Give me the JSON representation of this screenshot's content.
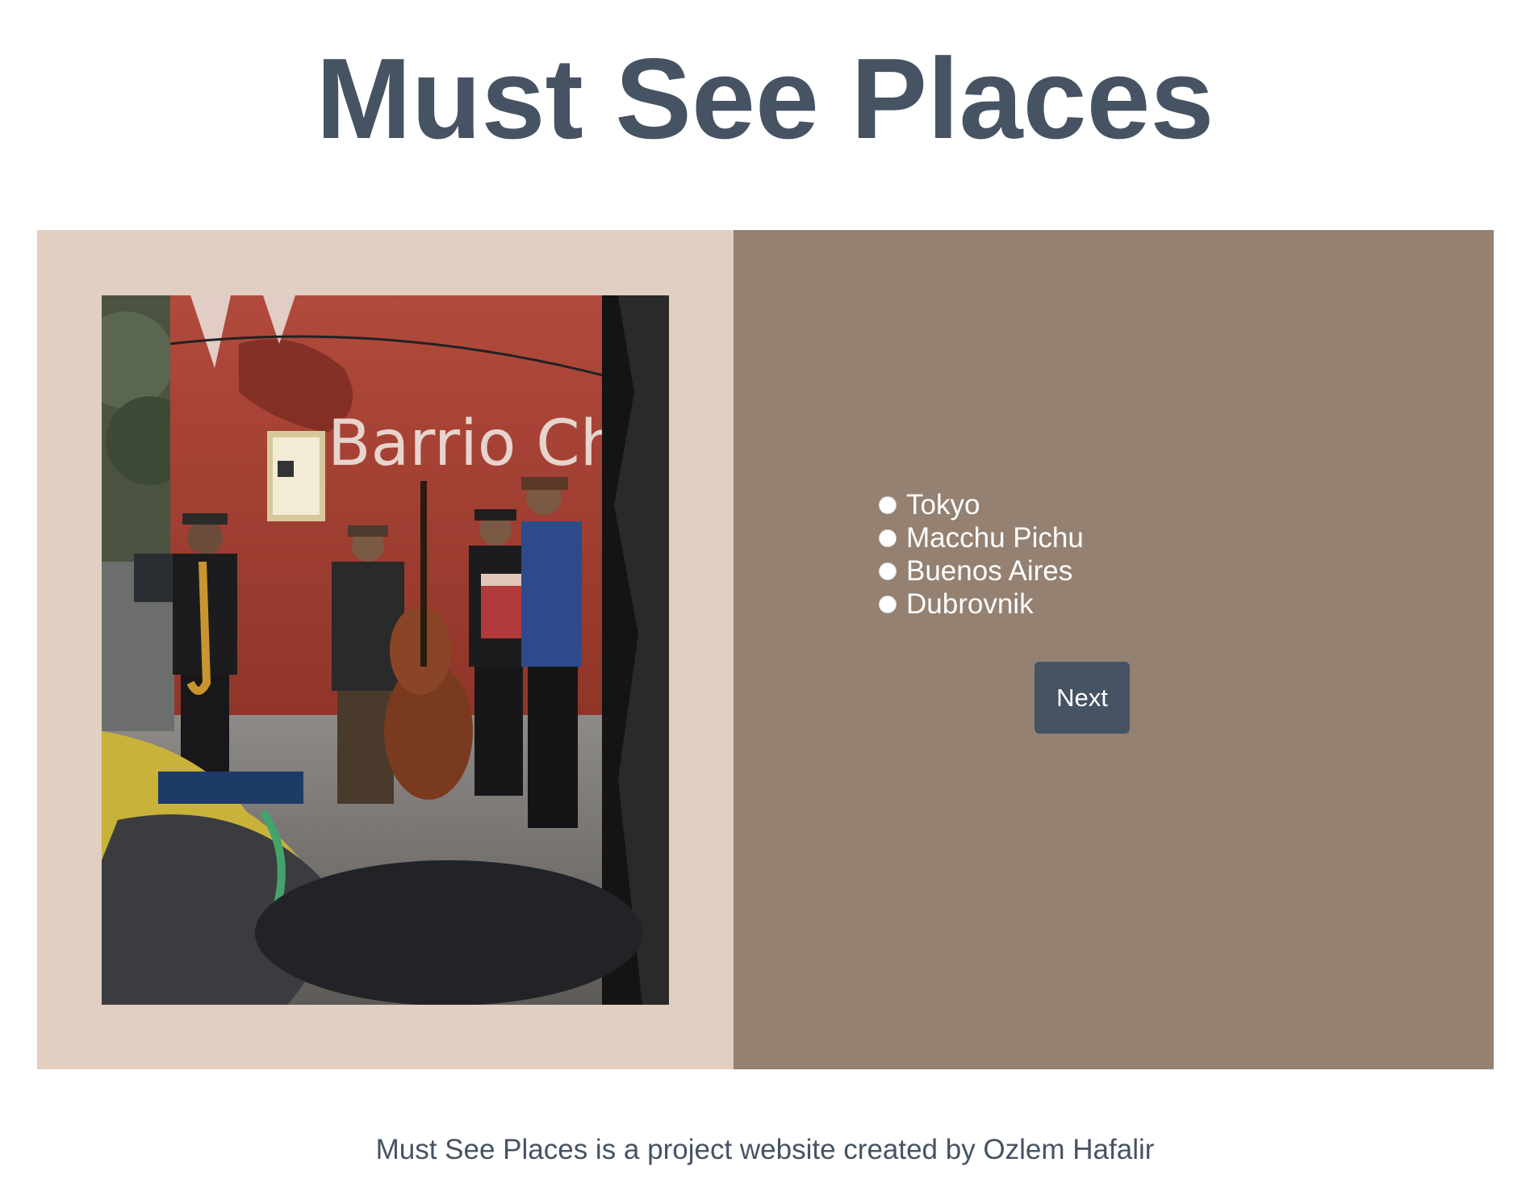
{
  "page": {
    "title": "Must See Places"
  },
  "quiz": {
    "photo": {
      "alt": "Street musicians with saxophone, double bass and accordion in front of a red mural wall",
      "icon": "photo-musicians-buenos-aires"
    },
    "options": [
      {
        "label": "Tokyo",
        "selected": false
      },
      {
        "label": "Macchu Pichu",
        "selected": false
      },
      {
        "label": "Buenos Aires",
        "selected": false
      },
      {
        "label": "Dubrovnik",
        "selected": false
      }
    ],
    "next_label": "Next"
  },
  "footer": {
    "text": "Must See Places is a project website created by Ozlem Hafalir"
  },
  "colors": {
    "title": "#465362",
    "image_pane_bg": "#e1cfc2",
    "choices_pane_bg": "#958171",
    "button_bg": "#465362",
    "text_light": "#ffffff"
  }
}
